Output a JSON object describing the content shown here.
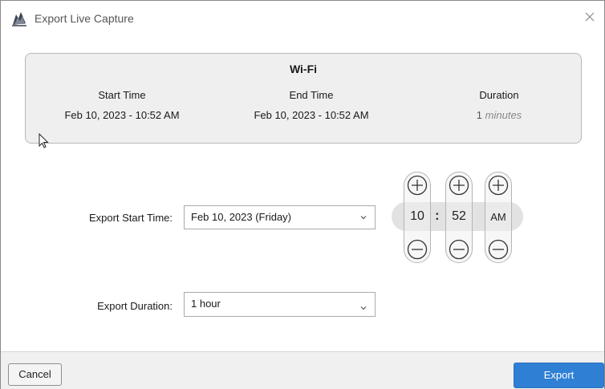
{
  "window": {
    "title": "Export Live Capture"
  },
  "summary": {
    "adapter": "Wi-Fi",
    "start_label": "Start Time",
    "start_value": "Feb 10, 2023 - 10:52 AM",
    "end_label": "End Time",
    "end_value": "Feb 10, 2023 - 10:52 AM",
    "duration_label": "Duration",
    "duration_value": "1",
    "duration_unit": "minutes"
  },
  "form": {
    "start_label": "Export Start Time:",
    "start_date_value": "Feb 10, 2023 (Friday)",
    "duration_label": "Export Duration:",
    "duration_value": "1 hour"
  },
  "time": {
    "hour": "10",
    "separator": ":",
    "minute": "52",
    "ampm": "AM"
  },
  "footer": {
    "cancel_label": "Cancel",
    "export_label": "Export"
  },
  "icons": {
    "app": "shark-fin-icon",
    "close": "close-icon",
    "plus": "plus-circle-icon",
    "minus": "minus-circle-icon",
    "chevron": "chevron-down-icon"
  },
  "colors": {
    "accent": "#2f80d5",
    "panel": "#efefef"
  }
}
